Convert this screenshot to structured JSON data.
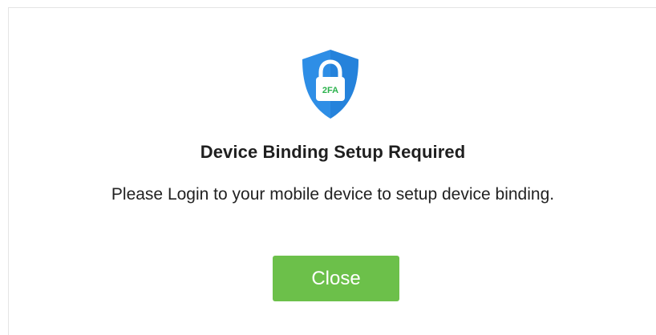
{
  "dialog": {
    "icon": "shield-2fa-lock-icon",
    "icon_label": "2FA",
    "title": "Device Binding Setup Required",
    "message": "Please Login to your mobile device to setup device binding.",
    "close_label": "Close"
  },
  "colors": {
    "shield": "#2e8ee6",
    "shield_dark": "#1a6fc4",
    "lock_body": "#ffffff",
    "lock_label": "#2bb24c",
    "button": "#6cc04a",
    "button_text": "#ffffff"
  }
}
